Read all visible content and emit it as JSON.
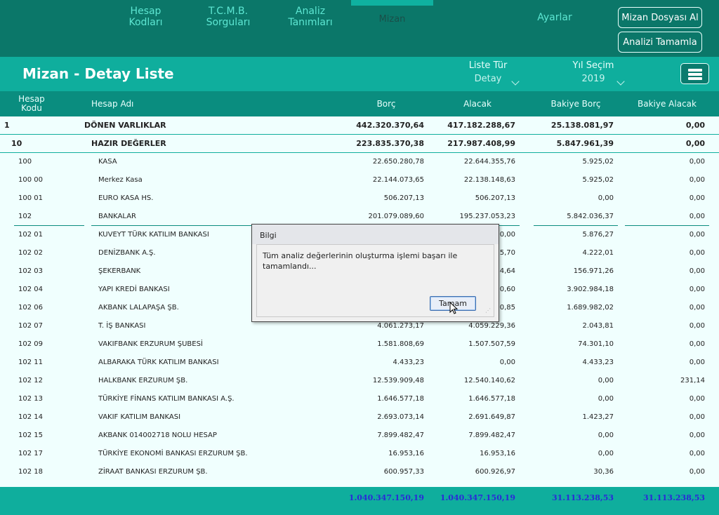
{
  "nav": {
    "tabs": [
      {
        "label": "Hesap\nKodları"
      },
      {
        "label": "T.C.M.B.\nSorguları"
      },
      {
        "label": "Analiz\nTanımları"
      },
      {
        "label": "Mizan"
      },
      {
        "label": "Ayarlar"
      }
    ],
    "buttons": {
      "mizan_dosyasi": "Mizan Dosyası Al",
      "analizi_tamamla": "Analizi Tamamla"
    }
  },
  "header": {
    "title": "Mizan - Detay Liste",
    "liste_tur": {
      "label": "Liste Tür",
      "value": "Detay"
    },
    "yil_secim": {
      "label": "Yıl Seçim",
      "value": "2019"
    }
  },
  "table": {
    "columns": {
      "kodu": "Hesap\nKodu",
      "adi": "Hesap Adı",
      "borc": "Borç",
      "alacak": "Alacak",
      "bakiye_borc": "Bakiye Borç",
      "bakiye_alacak": "Bakiye Alacak"
    },
    "rows": [
      {
        "kod": "1",
        "ad": "DÖNEN VARLIKLAR",
        "borc": "442.320.370,64",
        "alacak": "417.182.288,67",
        "bb": "25.138.081,97",
        "ba": "0,00"
      },
      {
        "kod": "10",
        "ad": "HAZIR DEĞERLER",
        "borc": "223.835.370,38",
        "alacak": "217.987.408,99",
        "bb": "5.847.961,39",
        "ba": "0,00"
      },
      {
        "kod": "100",
        "ad": "KASA",
        "borc": "22.650.280,78",
        "alacak": "22.644.355,76",
        "bb": "5.925,02",
        "ba": "0,00"
      },
      {
        "kod": "100 00",
        "ad": "Merkez Kasa",
        "borc": "22.144.073,65",
        "alacak": "22.138.148,63",
        "bb": "5.925,02",
        "ba": "0,00"
      },
      {
        "kod": "100 01",
        "ad": "EURO KASA HS.",
        "borc": "506.207,13",
        "alacak": "506.207,13",
        "bb": "0,00",
        "ba": "0,00"
      },
      {
        "kod": "102",
        "ad": "BANKALAR",
        "borc": "201.079.089,60",
        "alacak": "195.237.053,23",
        "bb": "5.842.036,37",
        "ba": "0,00"
      },
      {
        "kod": "102 01",
        "ad": "KUVEYT TÜRK KATILIM BANKASI",
        "borc": "",
        "alacak": "0,00",
        "bb": "5.876,27",
        "ba": "0,00"
      },
      {
        "kod": "102 02",
        "ad": "DENİZBANK A.Ş.",
        "borc": "",
        "alacak": "5,70",
        "bb": "4.222,01",
        "ba": "0,00"
      },
      {
        "kod": "102 03",
        "ad": "ŞEKERBANK",
        "borc": "",
        "alacak": "4,64",
        "bb": "156.971,26",
        "ba": "0,00"
      },
      {
        "kod": "102 04",
        "ad": "YAPI KREDİ BANKASI",
        "borc": "",
        "alacak": "0,60",
        "bb": "3.902.984,18",
        "ba": "0,00"
      },
      {
        "kod": "102 06",
        "ad": "AKBANK LALAPAŞA ŞB.",
        "borc": "",
        "alacak": "0,85",
        "bb": "1.689.982,02",
        "ba": "0,00"
      },
      {
        "kod": "102 07",
        "ad": "T. İŞ BANKASI",
        "borc": "4.061.273,17",
        "alacak": "4.059.229,36",
        "bb": "2.043,81",
        "ba": "0,00"
      },
      {
        "kod": "102 09",
        "ad": "VAKIFBANK ERZURUM ŞUBESİ",
        "borc": "1.581.808,69",
        "alacak": "1.507.507,59",
        "bb": "74.301,10",
        "ba": "0,00"
      },
      {
        "kod": "102 11",
        "ad": "ALBARAKA TÜRK KATILIM BANKASI",
        "borc": "4.433,23",
        "alacak": "0,00",
        "bb": "4.433,23",
        "ba": "0,00"
      },
      {
        "kod": "102 12",
        "ad": "HALKBANK ERZURUM ŞB.",
        "borc": "12.539.909,48",
        "alacak": "12.540.140,62",
        "bb": "0,00",
        "ba": "231,14"
      },
      {
        "kod": "102 13",
        "ad": "TÜRKİYE FİNANS KATILIM BANKASI A.Ş.",
        "borc": "1.646.577,18",
        "alacak": "1.646.577,18",
        "bb": "0,00",
        "ba": "0,00"
      },
      {
        "kod": "102 14",
        "ad": "VAKIF KATILIM BANKASI",
        "borc": "2.693.073,14",
        "alacak": "2.691.649,87",
        "bb": "1.423,27",
        "ba": "0,00"
      },
      {
        "kod": "102 15",
        "ad": "AKBANK 014002718 NOLU HESAP",
        "borc": "7.899.482,47",
        "alacak": "7.899.482,47",
        "bb": "0,00",
        "ba": "0,00"
      },
      {
        "kod": "102 17",
        "ad": "TÜRKİYE EKONOMİ BANKASI ERZURUM ŞB.",
        "borc": "16.953,16",
        "alacak": "16.953,16",
        "bb": "0,00",
        "ba": "0,00"
      },
      {
        "kod": "102 18",
        "ad": "ZİRAAT BANKASI ERZURUM ŞB.",
        "borc": "600.957,33",
        "alacak": "600.926,97",
        "bb": "30,36",
        "ba": "0,00"
      }
    ]
  },
  "footer": {
    "borc": "1.040.347.150,19",
    "alacak": "1.040.347.150,19",
    "bakiye_borc": "31.113.238,53",
    "bakiye_alacak": "31.113.238,53"
  },
  "dialog": {
    "title": "Bilgi",
    "message": "Tüm analiz değerlerinin oluşturma işlemi başarı ile tamamlandı...",
    "ok": "Tamam"
  }
}
